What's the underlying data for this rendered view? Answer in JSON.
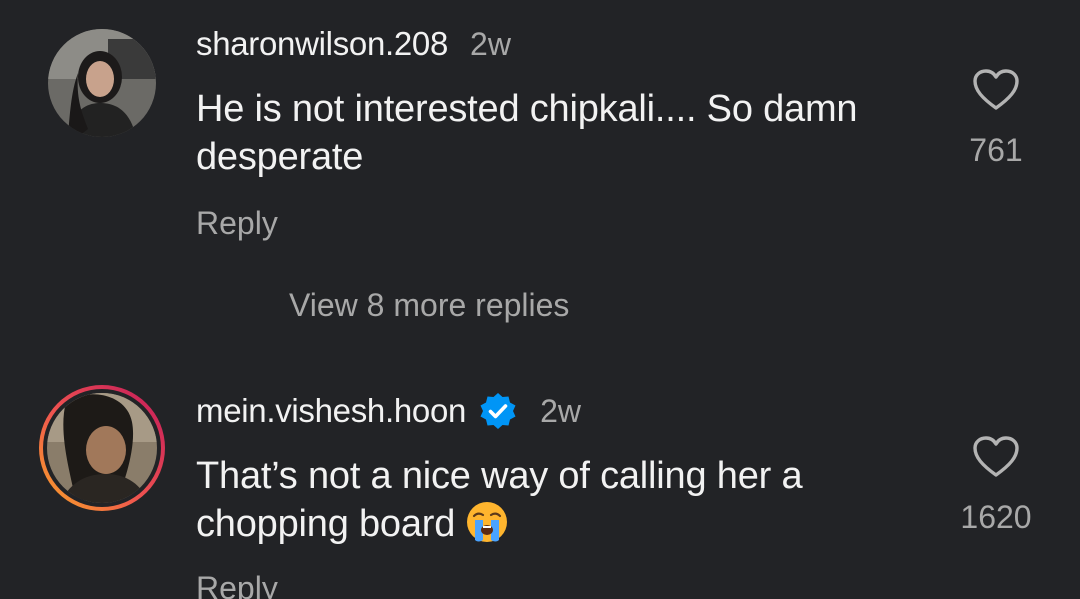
{
  "comments": [
    {
      "username": "sharonwilson.208",
      "time": "2w",
      "verified": false,
      "text": "He is not interested chipkali.... So damn desperate",
      "likes": "761",
      "reply_label": "Reply",
      "avatar_icon": "profile-photo-woman"
    },
    {
      "username": "mein.vishesh.hoon",
      "time": "2w",
      "verified": true,
      "text": "That’s not a nice way of calling her a chopping board",
      "emoji": "loudly-crying-face-emoji",
      "likes": "1620",
      "reply_label": "Reply",
      "avatar_icon": "profile-photo-man-story-ring"
    }
  ],
  "view_more_replies": "View 8 more replies",
  "colors": {
    "background": "#222326",
    "primary_text": "#f2f2f2",
    "secondary_text": "#a8a8a8",
    "verified_blue": "#0095f6"
  }
}
